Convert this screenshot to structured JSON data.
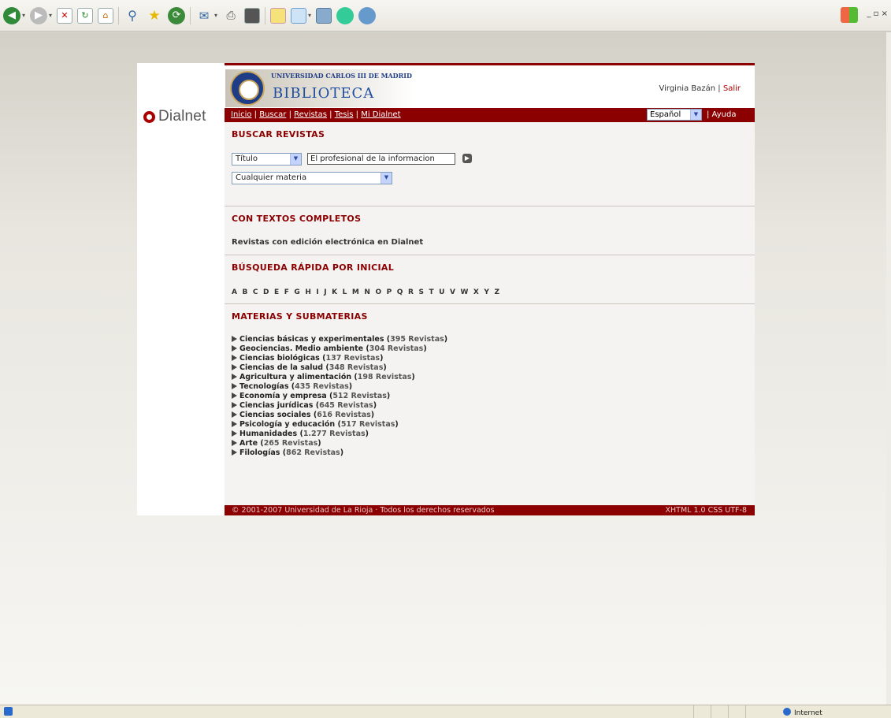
{
  "browser": {
    "status_zone": "Internet"
  },
  "site": {
    "logo_text": "Dialnet",
    "university": "UNIVERSIDAD CARLOS III DE MADRID",
    "library": "BIBLIOTECA",
    "user_name": "Virginia Bazán",
    "separator": "|",
    "logout": "Salir"
  },
  "nav": {
    "items": [
      "Inicio",
      "Buscar",
      "Revistas",
      "Tesis",
      "Mi Dialnet"
    ],
    "language": "Español",
    "help": "| Ayuda"
  },
  "search": {
    "title": "BUSCAR REVISTAS",
    "field_select": "Título",
    "query_value": "El profesional de la informacion",
    "materia_select": "Cualquier materia"
  },
  "fulltext": {
    "title": "CON TEXTOS COMPLETOS",
    "link": "Revistas con edición electrónica en Dialnet"
  },
  "quick": {
    "title": "BÚSQUEDA RÁPIDA POR INICIAL",
    "letters": "A B C D E F G H I J K L M N O P Q R S T U V W X Y Z"
  },
  "materias": {
    "title": "MATERIAS Y SUBMATERIAS",
    "items": [
      {
        "name": "Ciencias básicas y experimentales",
        "count": "395 Revistas"
      },
      {
        "name": "Geociencias. Medio ambiente",
        "count": "304 Revistas"
      },
      {
        "name": "Ciencias biológicas",
        "count": "137 Revistas"
      },
      {
        "name": "Ciencias de la salud",
        "count": "348 Revistas"
      },
      {
        "name": "Agricultura y alimentación",
        "count": "198 Revistas"
      },
      {
        "name": "Tecnologías",
        "count": "435 Revistas"
      },
      {
        "name": "Economía y empresa",
        "count": "512 Revistas"
      },
      {
        "name": "Ciencias jurídicas",
        "count": "645 Revistas"
      },
      {
        "name": "Ciencias sociales",
        "count": "616 Revistas"
      },
      {
        "name": "Psicología y educación",
        "count": "517 Revistas"
      },
      {
        "name": "Humanidades",
        "count": "1.277 Revistas"
      },
      {
        "name": "Arte",
        "count": "265 Revistas"
      },
      {
        "name": "Filologías",
        "count": "862 Revistas"
      }
    ]
  },
  "footer": {
    "copyright": "© 2001-2007 Universidad de La Rioja · Todos los derechos reservados",
    "standards": "XHTML 1.0 CSS UTF-8"
  }
}
